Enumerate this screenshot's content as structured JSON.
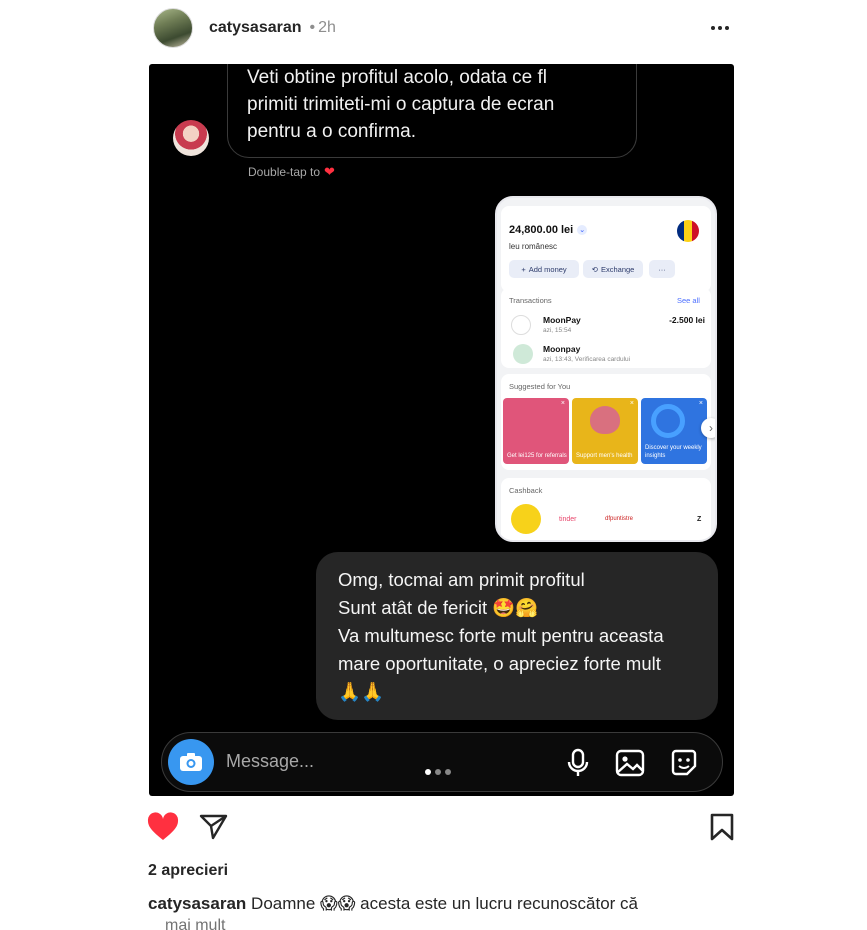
{
  "post": {
    "username": "catysasaran",
    "separator": "•",
    "time": "2h"
  },
  "dm": {
    "top_message_lines": [
      " Veti obtine profitul acolo, odata ce fl",
      "primiti trimiteti-mi o captura de ecran",
      "pentru a o confirma."
    ],
    "double_tap": "Double-tap to",
    "reply_lines": [
      "Omg, tocmai am primit profitul",
      "Sunt atât de fericit 🤩🤗",
      "Va multumesc forte mult pentru aceasta",
      "mare oportunitate, o apreciez forte mult",
      "🙏🙏"
    ],
    "composer_placeholder": "Message..."
  },
  "phone": {
    "balance": "24,800.00 lei",
    "currency": "leu românesc",
    "add_money": "Add money",
    "exchange": "Exchange",
    "more": "···",
    "transactions_title": "Transactions",
    "see_all": "See all",
    "transactions": [
      {
        "name": "MoonPay",
        "sub": "azi, 15:54",
        "amount": "-2.500 lei"
      },
      {
        "name": "Moonpay",
        "sub": "azi, 13:43, Verificarea cardului",
        "amount": ""
      }
    ],
    "suggested_title": "Suggested for You",
    "tiles": [
      {
        "label": "Get lei125 for referrals",
        "color": "#e0557a"
      },
      {
        "label": "Support men's health",
        "color": "#e8b51a"
      },
      {
        "label": "Discover your weekly insights",
        "color": "#2f74e0"
      }
    ],
    "cashback_title": "Cashback",
    "brands": [
      "tinder",
      "dfpuntistre",
      "Z"
    ]
  },
  "likes_text": "2 aprecieri",
  "caption": {
    "user": "catysasaran",
    "text": " Doamne 😱😱 acesta este un lucru recunoscător că",
    "more": "mai mult"
  },
  "colors": {
    "like_red": "#ff3040",
    "camera_blue": "#3897f0"
  }
}
